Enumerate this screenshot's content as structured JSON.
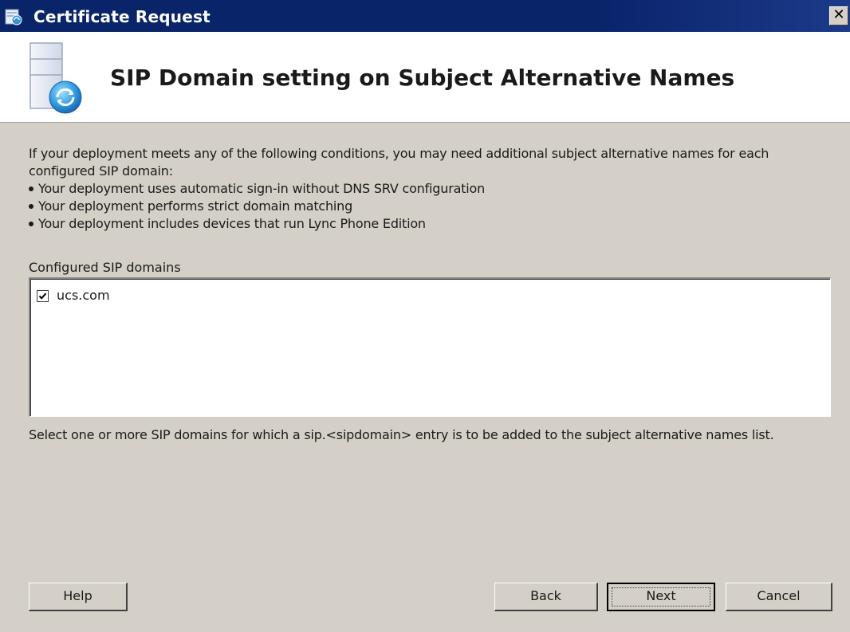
{
  "window": {
    "title": "Certificate Request",
    "close_glyph": "✕"
  },
  "banner": {
    "title": "SIP Domain setting on Subject Alternative Names",
    "icon": "server-certificate-icon"
  },
  "intro": {
    "text": "If your deployment meets any of the following conditions, you may need additional subject alternative names for each configured SIP domain:",
    "bullets": [
      "Your deployment uses automatic sign-in without DNS SRV configuration",
      "Your deployment performs strict domain matching",
      "Your deployment includes devices that run Lync Phone Edition"
    ]
  },
  "domains": {
    "label": "Configured SIP domains",
    "items": [
      {
        "label": "ucs.com",
        "checked": true
      }
    ]
  },
  "hint": "Select one or more SIP domains for which a sip.<sipdomain> entry is to be added to the subject alternative names list.",
  "buttons": {
    "help": "Help",
    "back": "Back",
    "next": "Next",
    "cancel": "Cancel"
  },
  "colors": {
    "titlebar": "#0a246a",
    "dialog_bg": "#d4d0c8",
    "banner_bg": "#ffffff"
  }
}
